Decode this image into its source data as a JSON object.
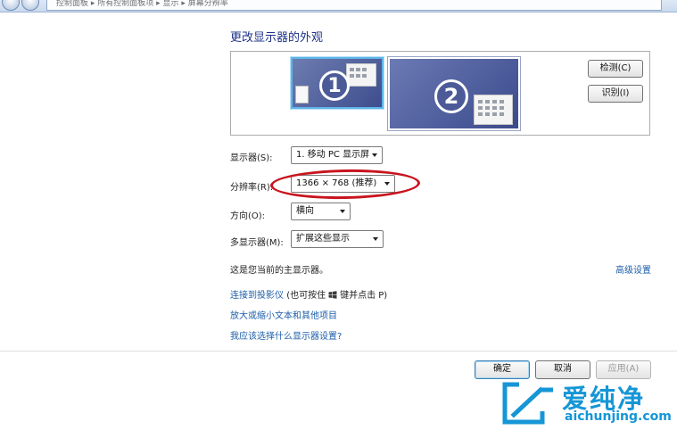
{
  "address_bar": {
    "path_text": "控制面板 ▸ 所有控制面板项 ▸ 显示 ▸ 屏幕分辨率"
  },
  "page": {
    "title": "更改显示器的外观"
  },
  "preview": {
    "monitor_1_label": "1",
    "monitor_2_label": "2",
    "detect_button": "检测(C)",
    "identify_button": "识别(I)"
  },
  "settings": {
    "display_label": "显示器(S):",
    "display_value": "1. 移动 PC 显示屏",
    "resolution_label": "分辨率(R):",
    "resolution_value": "1366 × 768 (推荐)",
    "orientation_label": "方向(O):",
    "orientation_value": "横向",
    "multiple_displays_label": "多显示器(M):",
    "multiple_displays_value": "扩展这些显示"
  },
  "status": {
    "main_display_text": "这是您当前的主显示器。",
    "advanced_settings_link": "高级设置"
  },
  "links": {
    "projector_link": "连接到投影仪",
    "projector_hint_prefix": "(也可按住",
    "projector_hint_suffix": "键并点击 P)",
    "text_size_link": "放大或缩小文本和其他项目",
    "which_settings_link": "我应该选择什么显示器设置?"
  },
  "footer": {
    "ok_button": "确定",
    "cancel_button": "取消",
    "apply_button": "应用(A)"
  },
  "watermark": {
    "brand_text": "爱纯净",
    "url_text": "aichunjing.com"
  },
  "colors": {
    "heading": "#1e3287",
    "link": "#1d5ea8",
    "highlight_ellipse": "#c8141e",
    "watermark": "#1596d6"
  }
}
